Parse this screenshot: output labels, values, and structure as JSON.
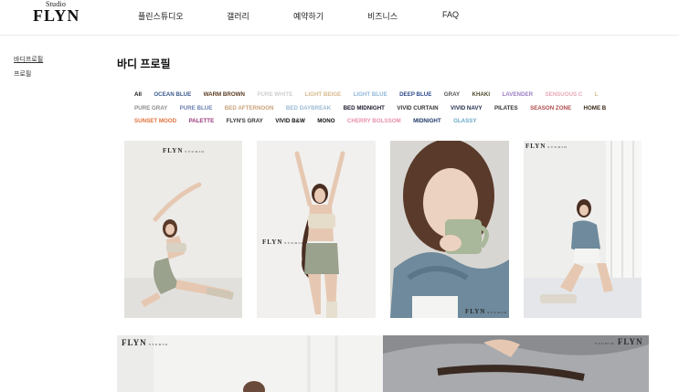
{
  "header": {
    "logo_top": "Studio",
    "logo_main": "FLYN",
    "nav": [
      "플린스튜디오",
      "갤러리",
      "예약하기",
      "비즈니스",
      "FAQ"
    ]
  },
  "sidebar": {
    "items": [
      {
        "label": "바디프로필",
        "active": true
      },
      {
        "label": "프로필",
        "active": false
      }
    ]
  },
  "page_title": "바디 프로필",
  "filters": {
    "rows": [
      [
        {
          "label": "All",
          "color": "#111111"
        },
        {
          "label": "OCEAN BLUE",
          "color": "#3a5a8c"
        },
        {
          "label": "WARM BROWN",
          "color": "#5a3a20"
        },
        {
          "label": "PURE WHITE",
          "color": "#cfcfcf"
        },
        {
          "label": "LIGHT BEIGE",
          "color": "#d8b98e"
        },
        {
          "label": "LIGHT BLUE",
          "color": "#8fb7d9"
        },
        {
          "label": "DEEP BLUE",
          "color": "#2b4a8c"
        },
        {
          "label": "GRAY",
          "color": "#555555"
        },
        {
          "label": "KHAKI",
          "color": "#4d4a2a"
        },
        {
          "label": "LAVENDER",
          "color": "#9b7fc4"
        },
        {
          "label": "SENSUOUS C",
          "color": "#e8a8b8"
        },
        {
          "label": "L",
          "color": "#d8b98e"
        }
      ],
      [
        {
          "label": "PURE GRAY",
          "color": "#8c8c8c"
        },
        {
          "label": "PURE BLUE",
          "color": "#6d82b0"
        },
        {
          "label": "BED AFTERNOON",
          "color": "#c9a27a"
        },
        {
          "label": "BED DAYBREAK",
          "color": "#9bbbd4"
        },
        {
          "label": "BED MIDNIGHT",
          "color": "#1a1a2e"
        },
        {
          "label": "VIVID CURTAIN",
          "color": "#333333"
        },
        {
          "label": "VIVID NAVY",
          "color": "#1f2a4a"
        },
        {
          "label": "PILATES",
          "color": "#333333"
        },
        {
          "label": "SEASON ZONE",
          "color": "#b04a4a"
        },
        {
          "label": "HOME B",
          "color": "#3a2a1a"
        }
      ],
      [
        {
          "label": "SUNSET MOOD",
          "color": "#e0703a"
        },
        {
          "label": "PALETTE",
          "color": "#9a3a7a"
        },
        {
          "label": "FLYN'S GRAY",
          "color": "#333333"
        },
        {
          "label": "VIVID B&W",
          "color": "#111111"
        },
        {
          "label": "MONO",
          "color": "#111111"
        },
        {
          "label": "CHERRY BOLSSOM",
          "color": "#e890a8"
        },
        {
          "label": "MIDNIGHT",
          "color": "#1f3a6a"
        },
        {
          "label": "GLASSY",
          "color": "#6aa8c8"
        }
      ]
    ]
  },
  "watermark": {
    "brand": "FLYN",
    "sub": "STUDIO"
  }
}
